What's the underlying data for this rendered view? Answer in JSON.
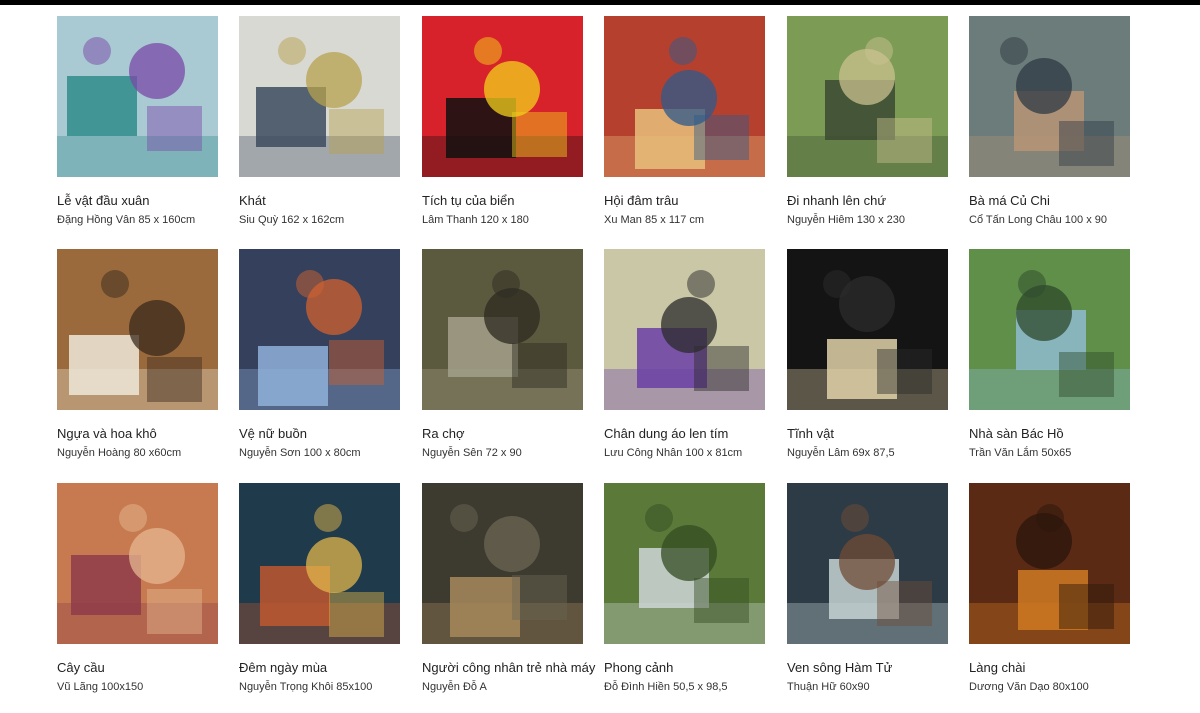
{
  "artworks": [
    {
      "title": "Lễ vật đầu xuân",
      "meta": "Đặng Hồng Vân 85 x 160cm",
      "palette": [
        "#a9c9d3",
        "#2f8d8a",
        "#7a4aa8"
      ]
    },
    {
      "title": "Khát",
      "meta": "Siu Quỳ 162 x 162cm",
      "palette": [
        "#d9d9d4",
        "#3c4b5e",
        "#b7a14e"
      ]
    },
    {
      "title": "Tích tụ của biển",
      "meta": "Lâm Thanh 120 x 180",
      "palette": [
        "#d8222b",
        "#111111",
        "#f2d21b"
      ]
    },
    {
      "title": "Hội đâm trâu",
      "meta": "Xu Man 85 x 117 cm",
      "palette": [
        "#b6402e",
        "#e7c07a",
        "#2c5a8c"
      ]
    },
    {
      "title": "Đi nhanh lên chứ",
      "meta": "Nguyễn Hiêm 130 x 230",
      "palette": [
        "#7c9b55",
        "#3b4a33",
        "#c9c28f"
      ]
    },
    {
      "title": "Bà má Củ Chi",
      "meta": "Cổ Tấn Long Châu 100 x 90",
      "palette": [
        "#6b7c7a",
        "#b89577",
        "#2f3a44"
      ]
    },
    {
      "title": "Ngựa và hoa khô",
      "meta": "Nguyễn Hoàng 80 x60cm",
      "palette": [
        "#9b6a3c",
        "#efe7d8",
        "#3a2a1c"
      ]
    },
    {
      "title": "Vệ nữ buồn",
      "meta": "Nguyễn Sơn 100 x 80cm",
      "palette": [
        "#35405c",
        "#8fb2d9",
        "#d0622f"
      ]
    },
    {
      "title": "Ra chợ",
      "meta": "Nguyễn Sên 72 x 90",
      "palette": [
        "#5c5a3e",
        "#a3a08a",
        "#2d2b22"
      ]
    },
    {
      "title": "Chân dung áo len tím",
      "meta": "Lưu Công Nhân 100 x 81cm",
      "palette": [
        "#c9c7a6",
        "#6a3ea6",
        "#2b2b2b"
      ]
    },
    {
      "title": "Tĩnh vật",
      "meta": "Nguyễn Lâm 69x 87,5",
      "palette": [
        "#141414",
        "#e0d2a8",
        "#2b2b2b"
      ]
    },
    {
      "title": "Nhà sàn Bác Hồ",
      "meta": "Trần Văn Lắm 50x65",
      "palette": [
        "#5f8f49",
        "#8fbcd0",
        "#2e4a2b"
      ]
    },
    {
      "title": "Cây cầu",
      "meta": "Vũ Lãng 100x150",
      "palette": [
        "#c77a4f",
        "#8e3b4a",
        "#e5b790"
      ]
    },
    {
      "title": "Đêm ngày mùa",
      "meta": "Nguyễn Trọng Khôi 85x100",
      "palette": [
        "#1f3a4a",
        "#c0582f",
        "#e2b64c"
      ]
    },
    {
      "title": "Người công nhân trẻ nhà máy",
      "meta": "Nguyễn Đỗ A",
      "palette": [
        "#3d3a30",
        "#a78a5c",
        "#6b6651"
      ]
    },
    {
      "title": "Phong cảnh",
      "meta": "Đỗ Đình Hiền 50,5 x 98,5",
      "palette": [
        "#5b7a3a",
        "#cfd6d8",
        "#344c22"
      ]
    },
    {
      "title": "Ven sông Hàm Tử",
      "meta": "Thuận Hữ 60x90",
      "palette": [
        "#2c3b45",
        "#c7d3d4",
        "#6f4c35"
      ]
    },
    {
      "title": "Làng chài",
      "meta": "Dương Văn Dạo 80x100",
      "palette": [
        "#5b2a14",
        "#d07a22",
        "#2a160c"
      ]
    }
  ]
}
